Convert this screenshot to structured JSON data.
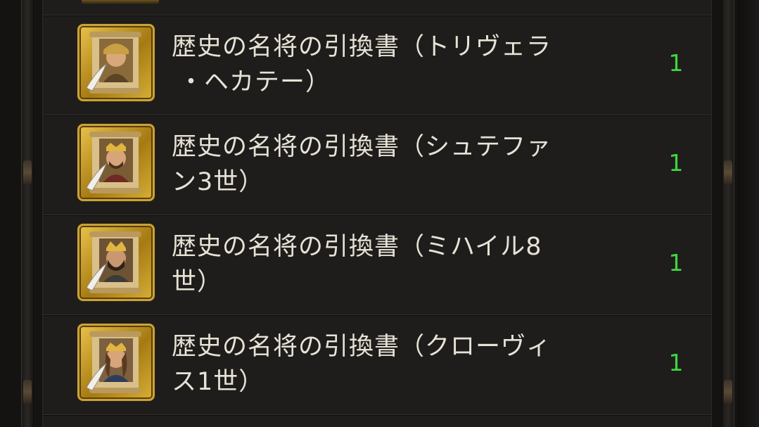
{
  "items": [
    {
      "name_line1": "歴史の名将の引換書（トリヴェラ",
      "name_line2": "・ヘカテー）",
      "quantity": "1",
      "icon": "hero-scroll-icon"
    },
    {
      "name_line1": "歴史の名将の引換書（シュテファ",
      "name_line2": "ン3世）",
      "quantity": "1",
      "icon": "hero-scroll-icon"
    },
    {
      "name_line1": "歴史の名将の引換書（ミハイル8",
      "name_line2": "世）",
      "quantity": "1",
      "icon": "hero-scroll-icon"
    },
    {
      "name_line1": "歴史の名将の引換書（クローヴィ",
      "name_line2": "ス1世）",
      "quantity": "1",
      "icon": "hero-scroll-icon"
    }
  ],
  "colors": {
    "quantity": "#3fd53f",
    "text": "#e7e2d6",
    "frame_gold": "#c9a33a",
    "panel": "#1e1d1b"
  }
}
